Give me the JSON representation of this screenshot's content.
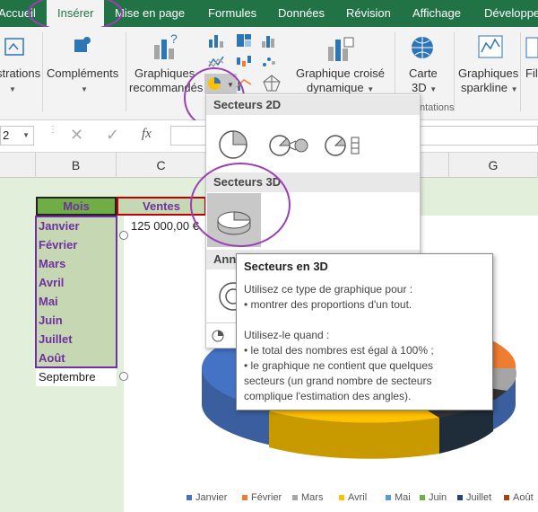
{
  "tabs": [
    "Accueil",
    "Insérer",
    "Mise en page",
    "Formules",
    "Données",
    "Révision",
    "Affichage",
    "Développe"
  ],
  "ribbon": {
    "illustrations": "strations",
    "complements": "Compléments",
    "graph_recommandes_1": "Graphiques",
    "graph_recommandes_2": "recommandés",
    "croise_1": "Graphique croisé",
    "croise_2": "dynamique",
    "carte_1": "Carte",
    "carte_2": "3D",
    "sparkline_1": "Graphiques",
    "sparkline_2": "sparkline",
    "filtres": "Filt",
    "group_presentations": "ntations"
  },
  "formula_bar": {
    "name_box": "2",
    "fx": "fx"
  },
  "columns": [
    "B",
    "C",
    "G"
  ],
  "table": {
    "header_mois": "Mois",
    "header_ventes": "Ventes",
    "first_value": "125 000,00 €",
    "months": [
      "Janvier",
      "Février",
      "Mars",
      "Avril",
      "Mai",
      "Juin",
      "Juillet",
      "Août"
    ],
    "extra_month": "Septembre"
  },
  "menu": {
    "section_2d": "Secteurs 2D",
    "section_3d": "Secteurs 3D",
    "section_ann": "Ann"
  },
  "tooltip": {
    "title": "Secteurs en 3D",
    "lines": [
      "Utilisez ce type de graphique pour :",
      "• montrer des proportions d'un tout.",
      "",
      "Utilisez-le quand :",
      "• le total des nombres est égal à 100% ;",
      "• le graphique ne contient que quelques",
      "secteurs (un grand nombre de secteurs",
      "complique l'estimation des angles)."
    ]
  },
  "legend": [
    {
      "label": "Janvier",
      "color": "#4472c4"
    },
    {
      "label": "Février",
      "color": "#ed7d31"
    },
    {
      "label": "Mars",
      "color": "#a5a5a5"
    },
    {
      "label": "Avril",
      "color": "#ffc000"
    },
    {
      "label": "Mai",
      "color": "#5b9bd5"
    },
    {
      "label": "Juin",
      "color": "#70ad47"
    },
    {
      "label": "Juillet",
      "color": "#264478"
    },
    {
      "label": "Août",
      "color": "#9e480e"
    }
  ],
  "colors": {
    "accent": "#217346",
    "highlight": "#7030a0",
    "pie_selected": "#d0d0d0"
  }
}
